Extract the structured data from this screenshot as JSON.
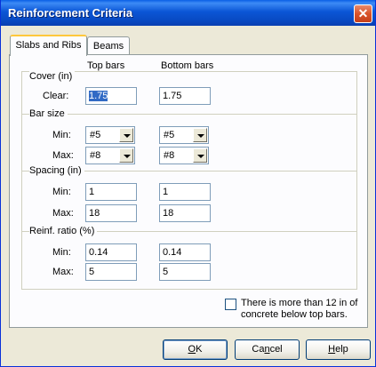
{
  "window": {
    "title": "Reinforcement Criteria",
    "close_glyph": "✕"
  },
  "tabs": [
    {
      "label": "Slabs and Ribs",
      "active": true
    },
    {
      "label": "Beams",
      "active": false
    }
  ],
  "columns": {
    "top": "Top bars",
    "bottom": "Bottom bars"
  },
  "cover": {
    "title": "Cover (in)",
    "clear_label": "Clear:",
    "top": "1.75",
    "bottom": "1.75"
  },
  "bar_size": {
    "title": "Bar size",
    "min_label": "Min:",
    "max_label": "Max:",
    "min_top": "#5",
    "min_bottom": "#5",
    "max_top": "#8",
    "max_bottom": "#8"
  },
  "spacing": {
    "title": "Spacing (in)",
    "min_label": "Min:",
    "max_label": "Max:",
    "min_top": "1",
    "min_bottom": "1",
    "max_top": "18",
    "max_bottom": "18"
  },
  "ratio": {
    "title": "Reinf. ratio (%)",
    "min_label": "Min:",
    "max_label": "Max:",
    "min_top": "0.14",
    "min_bottom": "0.14",
    "max_top": "5",
    "max_bottom": "5"
  },
  "checkbox": {
    "label": "There is more than 12 in of concrete below top bars.",
    "checked": false
  },
  "buttons": {
    "ok_accel": "O",
    "ok_rest": "K",
    "cancel_pre": "Ca",
    "cancel_accel": "n",
    "cancel_post": "cel",
    "help_accel": "H",
    "help_rest": "elp"
  },
  "colors": {
    "titlebar": "#0b56d6",
    "dialog_bg": "#ece9d8",
    "selection": "#316ac5",
    "close_button": "#d9532a"
  }
}
